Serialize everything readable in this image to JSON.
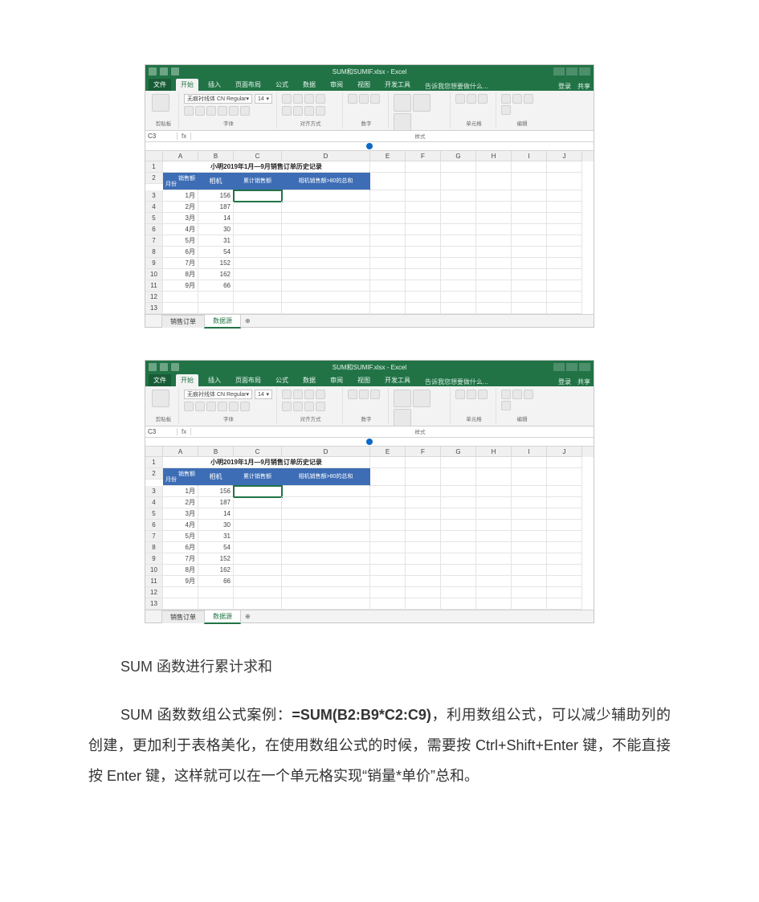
{
  "app_title": "SUM和SUMIF.xlsx - Excel",
  "ribbon": {
    "quick_icons": [
      "save",
      "undo",
      "redo"
    ],
    "tabs": [
      "文件",
      "开始",
      "插入",
      "页面布局",
      "公式",
      "数据",
      "审阅",
      "视图",
      "开发工具"
    ],
    "active_tab": "开始",
    "tell_me": "告诉我您想要做什么...",
    "signin": "登录",
    "share": "共享",
    "groups": {
      "clipboard": "剪贴板",
      "font": "字体",
      "font_name": "无痕衬线体 CN Regular",
      "font_size": "14",
      "alignment": "对齐方式",
      "number": "数字",
      "styles": "样式",
      "cells": "单元格",
      "editing": "编辑"
    }
  },
  "grid": {
    "name_box": "C3",
    "formula": "",
    "columns": [
      "",
      "A",
      "B",
      "C",
      "D",
      "E",
      "F",
      "G",
      "H",
      "I",
      "J"
    ],
    "title_row_text": "小明2019年1月—9月销售订单历史记录",
    "header_cells": {
      "month_top": "销售额",
      "month_bottom": "月份",
      "b": "相机",
      "c": "累计销售额",
      "d": "相机销售额>80的总和"
    },
    "rows": [
      {
        "n": "1"
      },
      {
        "n": "2"
      },
      {
        "n": "3",
        "a": "1月",
        "b": "156"
      },
      {
        "n": "4",
        "a": "2月",
        "b": "187"
      },
      {
        "n": "5",
        "a": "3月",
        "b": "14"
      },
      {
        "n": "6",
        "a": "4月",
        "b": "30"
      },
      {
        "n": "7",
        "a": "5月",
        "b": "31"
      },
      {
        "n": "8",
        "a": "6月",
        "b": "54"
      },
      {
        "n": "9",
        "a": "7月",
        "b": "152"
      },
      {
        "n": "10",
        "a": "8月",
        "b": "162"
      },
      {
        "n": "11",
        "a": "9月",
        "b": "66"
      },
      {
        "n": "12"
      },
      {
        "n": "13"
      }
    ]
  },
  "sheets": {
    "tab1": "销售订单",
    "tab2": "数据源",
    "active": "数据源"
  },
  "text": {
    "caption": "SUM 函数进行累计求和",
    "para_prefix": "SUM 函数数组公式案例：",
    "formula_bold": "=SUM(B2:B9*C2:C9)",
    "para_suffix": "，利用数组公式，可以减少辅助列的创建，更加利于表格美化，在使用数组公式的时候，需要按 Ctrl+Shift+Enter 键，不能直接按 Enter 键，这样就可以在一个单元格实现“销量*单价”总和。"
  }
}
